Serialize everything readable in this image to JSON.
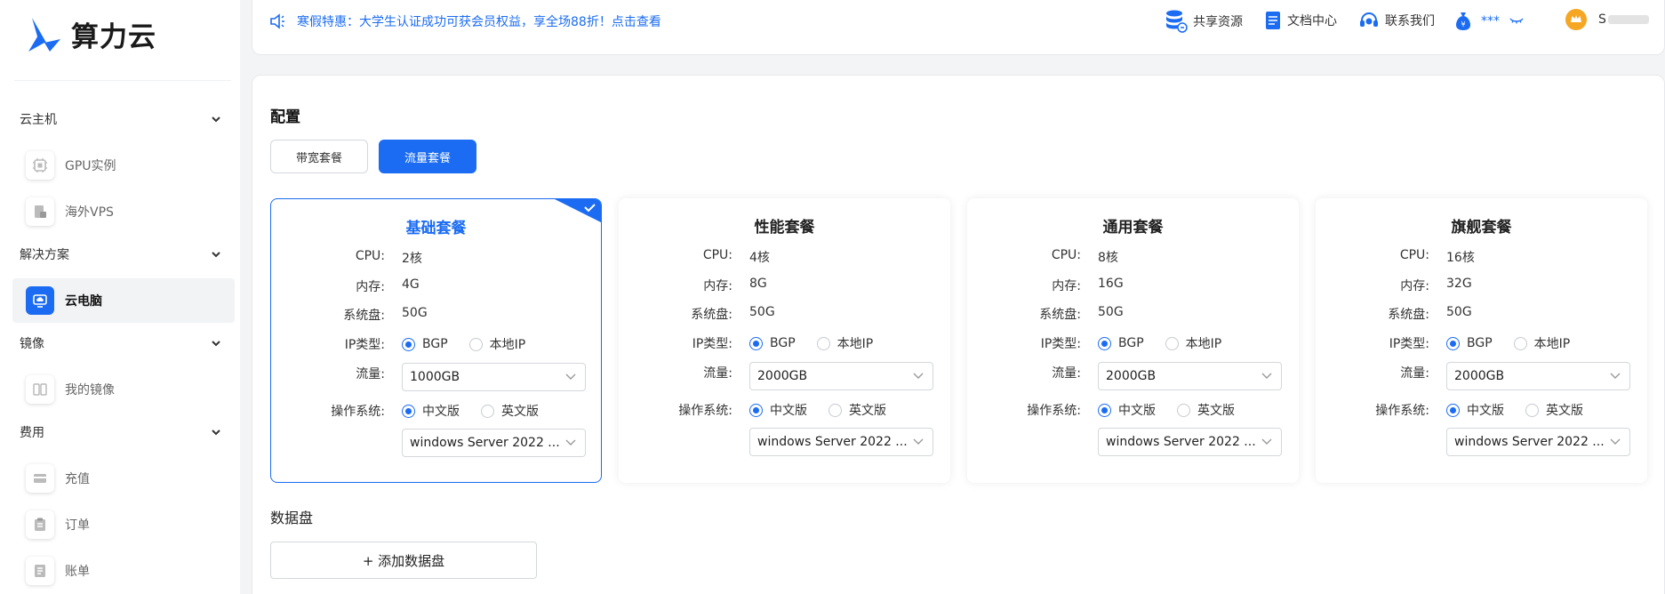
{
  "brand": {
    "name": "算力云"
  },
  "sidebar": {
    "sections": [
      {
        "label": "云主机",
        "items": [
          {
            "label": "GPU实例"
          },
          {
            "label": "海外VPS"
          }
        ]
      },
      {
        "label": "解决方案",
        "items": [
          {
            "label": "云电脑"
          }
        ]
      },
      {
        "label": "镜像",
        "items": [
          {
            "label": "我的镜像"
          }
        ]
      },
      {
        "label": "费用",
        "items": [
          {
            "label": "充值"
          },
          {
            "label": "订单"
          },
          {
            "label": "账单"
          }
        ]
      }
    ]
  },
  "topbar": {
    "notice": "寒假特惠：大学生认证成功可获会员权益，享全场88折！点击查看",
    "nav": [
      {
        "label": "共享资源"
      },
      {
        "label": "文档中心"
      },
      {
        "label": "联系我们"
      }
    ],
    "balance": "***",
    "user": "S"
  },
  "main": {
    "title": "配置",
    "tabs": [
      {
        "label": "带宽套餐"
      },
      {
        "label": "流量套餐"
      }
    ],
    "active_tab": "流量套餐",
    "labels": {
      "cpu": "CPU:",
      "mem": "内存:",
      "disk": "系统盘:",
      "ip": "IP类型:",
      "traffic": "流量:",
      "os": "操作系统:"
    },
    "radio_labels": {
      "bgp": "BGP",
      "local": "本地IP",
      "cn": "中文版",
      "en": "英文版"
    },
    "plans": [
      {
        "name": "基础套餐",
        "cpu": "2核",
        "mem": "4G",
        "disk": "50G",
        "traffic": "1000GB",
        "os": "windows Server 2022 ..."
      },
      {
        "name": "性能套餐",
        "cpu": "4核",
        "mem": "8G",
        "disk": "50G",
        "traffic": "2000GB",
        "os": "windows Server 2022 ..."
      },
      {
        "name": "通用套餐",
        "cpu": "8核",
        "mem": "16G",
        "disk": "50G",
        "traffic": "2000GB",
        "os": "windows Server 2022 ..."
      },
      {
        "name": "旗舰套餐",
        "cpu": "16核",
        "mem": "32G",
        "disk": "50G",
        "traffic": "2000GB",
        "os": "windows Server 2022 ..."
      }
    ],
    "data_disk": {
      "label": "数据盘",
      "add_button": "+ 添加数据盘"
    }
  },
  "colors": {
    "accent": "#1b6cf2"
  }
}
